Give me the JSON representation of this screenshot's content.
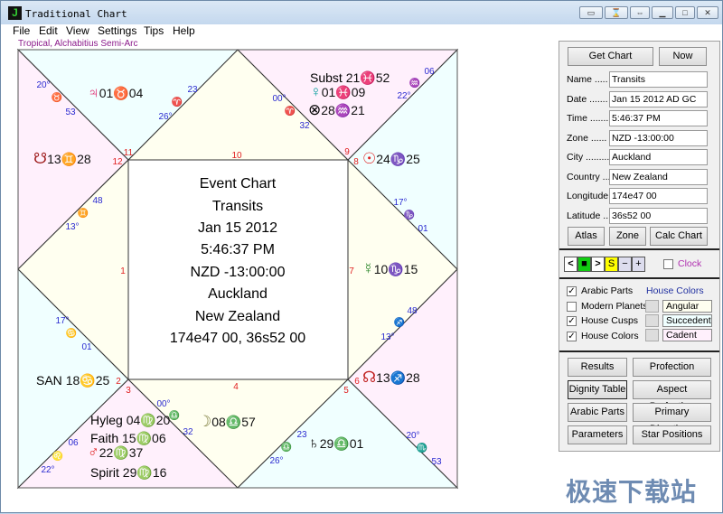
{
  "window": {
    "title": "Traditional Chart",
    "app_icon": "J"
  },
  "menu": [
    "File",
    "Edit",
    "View",
    "Settings",
    "Tips",
    "Help"
  ],
  "subtitle": "Tropical, Alchabitius Semi-Arc",
  "colors": {
    "angular": "#fffff0",
    "succedent": "#f0ffff",
    "cadent": "#fff0fc",
    "cusp_text": "#2a2ad0",
    "house_num": "#e02020"
  },
  "center": [
    "Event Chart",
    "Transits",
    "Jan 15 2012",
    "5:46:37 PM",
    "NZD -13:00:00",
    "Auckland",
    "New Zealand",
    "174e47 00, 36s52 00"
  ],
  "house_numbers": [
    "1",
    "2",
    "3",
    "4",
    "5",
    "6",
    "7",
    "8",
    "9",
    "10",
    "11",
    "12"
  ],
  "cusps": [
    [
      "20°",
      "♉",
      "53"
    ],
    [
      "23",
      "♈",
      "26°"
    ],
    [
      "00°",
      "♈",
      "32"
    ],
    [
      "06",
      "♒",
      "22°"
    ],
    [
      "17°",
      "♑",
      "01"
    ],
    [
      "48",
      "♐",
      "13°"
    ],
    [
      "48",
      "♊",
      "13°"
    ],
    [
      "17°",
      "♋",
      "01"
    ],
    [
      "00°",
      "♎",
      "32"
    ],
    [
      "06",
      "♌",
      "22°"
    ],
    [
      "23",
      "♎",
      "26°"
    ],
    [
      "20°",
      "♏",
      "53"
    ]
  ],
  "points": [
    {
      "glyph": "♃",
      "deg": "01",
      "sign": "♉",
      "min": "04",
      "name": "Jupiter"
    },
    {
      "glyph": "☋",
      "deg": "13",
      "sign": "♊",
      "min": "28",
      "name": "South Node"
    },
    {
      "glyph": "Subst ",
      "deg": "21",
      "sign": "♓",
      "min": "52",
      "name": "Subst"
    },
    {
      "glyph": "♀",
      "deg": "01",
      "sign": "♓",
      "min": "09",
      "name": "Venus"
    },
    {
      "glyph": "⊗",
      "deg": "28",
      "sign": "♒",
      "min": "21",
      "name": "Fortune"
    },
    {
      "glyph": "☉",
      "deg": "24",
      "sign": "♑",
      "min": "25",
      "name": "Sun"
    },
    {
      "glyph": "☿",
      "deg": "10",
      "sign": "♑",
      "min": "15",
      "name": "Mercury"
    },
    {
      "glyph": "☊",
      "deg": "13",
      "sign": "♐",
      "min": "28",
      "name": "North Node"
    },
    {
      "glyph": "SAN ",
      "deg": "18",
      "sign": "♋",
      "min": "25",
      "name": "SAN"
    },
    {
      "glyph": "Hyleg ",
      "deg": "04",
      "sign": "♍",
      "min": "20",
      "name": "Hyleg"
    },
    {
      "glyph": "Faith ",
      "deg": "15",
      "sign": "♍",
      "min": "06",
      "name": "Faith"
    },
    {
      "glyph": "♂",
      "deg": "22",
      "sign": "♍",
      "min": "37",
      "name": "Mars"
    },
    {
      "glyph": "Spirit ",
      "deg": "29",
      "sign": "♍",
      "min": "16",
      "name": "Spirit"
    },
    {
      "glyph": "☽",
      "deg": "08",
      "sign": "♎",
      "min": "57",
      "name": "Moon"
    },
    {
      "glyph": "♄",
      "deg": "29",
      "sign": "♎",
      "min": "01",
      "name": "Saturn"
    }
  ],
  "panel": {
    "get_chart": "Get Chart",
    "now": "Now",
    "fields": [
      {
        "label": "Name .....",
        "value": "Transits"
      },
      {
        "label": "Date .......",
        "value": "Jan 15 2012 AD GC"
      },
      {
        "label": "Time .......",
        "value": "5:46:37 PM"
      },
      {
        "label": "Zone ......",
        "value": "NZD -13:00:00"
      },
      {
        "label": "City ..........",
        "value": "Auckland"
      },
      {
        "label": "Country ...",
        "value": "New Zealand"
      },
      {
        "label": "Longitude",
        "value": "174e47 00"
      },
      {
        "label": "Latitude ..",
        "value": "36s52 00"
      }
    ],
    "atlas": "Atlas",
    "zone": "Zone",
    "calc": "Calc Chart",
    "nav": [
      "<",
      "■",
      ">",
      "S",
      "−",
      "+"
    ],
    "clock": {
      "label": "Clock",
      "checked": false
    },
    "options": [
      {
        "label": "Arabic Parts",
        "checked": true
      },
      {
        "label": "Modern Planets",
        "checked": false
      },
      {
        "label": "House Cusps",
        "checked": true
      },
      {
        "label": "House Colors",
        "checked": true
      }
    ],
    "house_colors_title": "House Colors",
    "house_colors": [
      "Angular",
      "Succedent",
      "Cadent"
    ],
    "buttons": [
      [
        "Results",
        "Profection"
      ],
      [
        "Dignity Table",
        "Aspect Perfection"
      ],
      [
        "Arabic Parts",
        "Primary Directions"
      ],
      [
        "Parameters",
        "Star Positions"
      ]
    ]
  },
  "watermark": "极速下载站"
}
